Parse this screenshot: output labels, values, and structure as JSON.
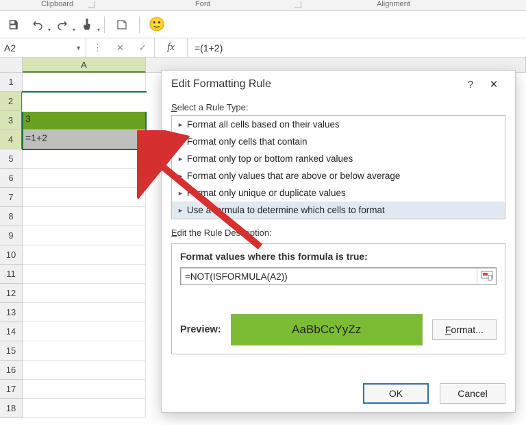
{
  "ribbon": {
    "groups": {
      "clipboard": "Clipboard",
      "font": "Font",
      "alignment": "Alignment"
    }
  },
  "namebox": {
    "value": "A2"
  },
  "formulabar": {
    "fx": "fx",
    "value": "=(1+2)"
  },
  "grid": {
    "col_label": "A",
    "rows": [
      "1",
      "2",
      "3",
      "4",
      "5",
      "6",
      "7",
      "8",
      "9",
      "10",
      "11",
      "12",
      "13",
      "14",
      "15",
      "16",
      "17",
      "18"
    ],
    "cells": {
      "A2": "=(1+2)",
      "A3": "3",
      "A4": "=1+2"
    }
  },
  "dialog": {
    "title": "Edit Formatting Rule",
    "help": "?",
    "close": "✕",
    "select_label_pre": "S",
    "select_label_rest": "elect a Rule Type:",
    "rule_types": [
      "Format all cells based on their values",
      "Format only cells that contain",
      "Format only top or bottom ranked values",
      "Format only values that are above or below average",
      "Format only unique or duplicate values",
      "Use a formula to determine which cells to format"
    ],
    "edit_label_pre": "E",
    "edit_label_rest": "dit the Rule Description:",
    "formula_heading": "Format values where this formula is true:",
    "formula_value": "=NOT(ISFORMULA(A2))",
    "preview_label": "Preview:",
    "preview_text": "AaBbCcYyZz",
    "format_btn_pre": "F",
    "format_btn_rest": "ormat...",
    "ok": "OK",
    "cancel": "Cancel"
  }
}
